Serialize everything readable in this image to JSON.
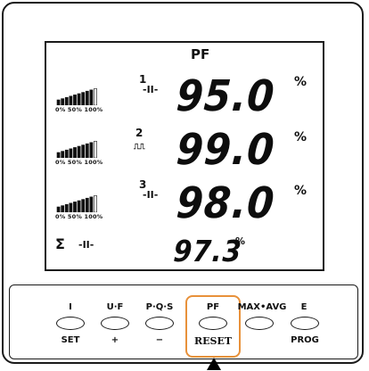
{
  "display": {
    "parameter": "PF",
    "phases": [
      {
        "num": "1",
        "symbol": "-II-",
        "value": "95.0",
        "unit": "%",
        "ticks": "0% 50% 100%",
        "level": 0.9
      },
      {
        "num": "2",
        "symbol": "⎍⎍",
        "value": "99.0",
        "unit": "%",
        "ticks": "0% 50% 100%",
        "level": 0.9
      },
      {
        "num": "3",
        "symbol": "-II-",
        "value": "98.0",
        "unit": "%",
        "ticks": "0% 50% 100%",
        "level": 0.9
      }
    ],
    "total": {
      "symbol": "Σ",
      "cap_symbol": "-II-",
      "value": "97.3",
      "unit": "%"
    }
  },
  "buttons": [
    {
      "top": "I",
      "bottom": "SET"
    },
    {
      "top": "U·F",
      "bottom": "+"
    },
    {
      "top": "P·Q·S",
      "bottom": "−"
    },
    {
      "top": "PF",
      "bottom": "RESET"
    },
    {
      "top": "MAX•AVG",
      "bottom": ""
    },
    {
      "top": "E",
      "bottom": "PROG"
    }
  ],
  "colors": {
    "highlight": "#e8913a",
    "ink": "#111111"
  }
}
